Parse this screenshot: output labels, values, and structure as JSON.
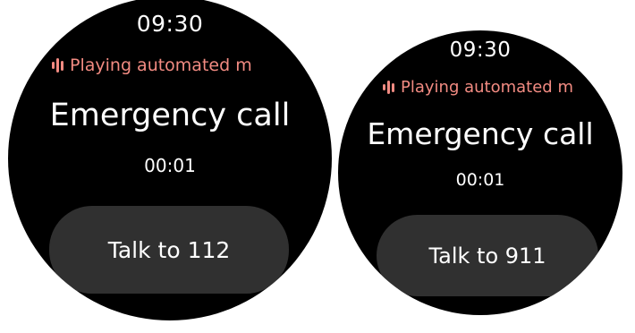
{
  "watches": [
    {
      "clock": "09:30",
      "status_icon": "audio-wave-icon",
      "status_text": "Playing automated m",
      "title": "Emergency call",
      "timer": "00:01",
      "talk_button": "Talk to 112"
    },
    {
      "clock": "09:30",
      "status_icon": "audio-wave-icon",
      "status_text": "Playing automated m",
      "title": "Emergency call",
      "timer": "00:01",
      "talk_button": "Talk to 911"
    }
  ],
  "colors": {
    "screen_background": "#000000",
    "status_accent": "#f28b82",
    "button_background": "#303030",
    "text": "#ffffff"
  }
}
